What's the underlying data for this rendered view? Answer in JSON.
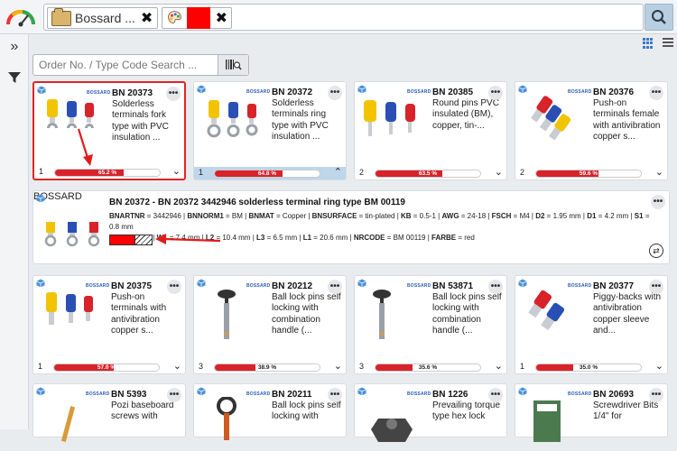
{
  "header": {
    "tab_folder_label": "Bossard ...",
    "color_filter_hex": "#ff0000",
    "search_button_icon": "search-icon"
  },
  "sidebar": {
    "expand_icon": "double-chevron-right-icon",
    "filter_icon": "funnel-icon"
  },
  "view": {
    "grid_icon": "grid-view-icon",
    "list_icon": "list-view-icon"
  },
  "search": {
    "placeholder": "Order No. / Type Code Search ..."
  },
  "brand_label": "BOSSARD",
  "cards": [
    {
      "code": "BN 20373",
      "desc": "Solderless terminals fork type with PVC insulation ...",
      "count": "1",
      "match": 0.652,
      "match_label": "65.2 %",
      "selected": true,
      "expander": "chevron-down"
    },
    {
      "code": "BN 20372",
      "desc": "Solderless terminals ring type with PVC insulation ...",
      "count": "1",
      "match": 0.648,
      "match_label": "64.8 %",
      "highlight": true,
      "expander": "chevron-up"
    },
    {
      "code": "BN 20385",
      "desc": "Round pins PVC insulated (BM), copper, tin-...",
      "count": "2",
      "match": 0.635,
      "match_label": "63.5 %",
      "expander": "chevron-down"
    },
    {
      "code": "BN 20376",
      "desc": "Push-on terminals female with antivibration copper s...",
      "count": "2",
      "match": 0.596,
      "match_label": "59.6 %",
      "expander": "chevron-down"
    },
    {
      "code": "BN 20375",
      "desc": "Push-on terminals with antivibration copper s...",
      "count": "1",
      "match": 0.57,
      "match_label": "57.0 %",
      "expander": "chevron-down"
    },
    {
      "code": "BN 20212",
      "desc": "Ball lock pins self locking with combination handle (...",
      "count": "3",
      "match": 0.389,
      "match_label": "38.9 %",
      "expander": "chevron-down"
    },
    {
      "code": "BN 53871",
      "desc": "Ball lock pins self locking with combination handle (...",
      "count": "3",
      "match": 0.356,
      "match_label": "35.6 %",
      "expander": "chevron-down"
    },
    {
      "code": "BN 20377",
      "desc": "Piggy-backs with antivibration copper sleeve and...",
      "count": "1",
      "match": 0.35,
      "match_label": "35.0 %",
      "expander": "chevron-down"
    },
    {
      "code": "BN 5393",
      "desc": "Pozi baseboard screws with"
    },
    {
      "code": "BN 20211",
      "desc": "Ball lock pins self locking with"
    },
    {
      "code": "BN 1226",
      "desc": "Prevailing torque type hex lock"
    },
    {
      "code": "BN 20693",
      "desc": "Screwdriver Bits 1/4\" for"
    }
  ],
  "detail": {
    "title": "BN 20372 - BN 20372 3442946 solderless terminal ring type BM 00119",
    "attrs_line1": [
      [
        "BNARTNR",
        "3442946"
      ],
      [
        "BNNORM1",
        "BM"
      ],
      [
        "BNMAT",
        "Copper"
      ],
      [
        "BNSURFACE",
        "tin-plated"
      ],
      [
        "KB",
        "0.5-1"
      ],
      [
        "AWG",
        "24-18"
      ],
      [
        "FSCH",
        "M4"
      ],
      [
        "D2",
        "1.95 mm"
      ],
      [
        "D1",
        "4.2 mm"
      ],
      [
        "S1",
        "0.8 mm"
      ]
    ],
    "attrs_line2": [
      [
        "D3",
        "4.3 mm"
      ],
      [
        "W1",
        "7.4 mm"
      ],
      [
        "L2",
        "10.4 mm"
      ],
      [
        "L3",
        "6.5 mm"
      ],
      [
        "L1",
        "20.6 mm"
      ],
      [
        "NRCODE",
        "BM 00119"
      ],
      [
        "FARBE",
        "red"
      ]
    ],
    "color_swatch": "#ff0000",
    "compare_icon": "compare-icon"
  }
}
